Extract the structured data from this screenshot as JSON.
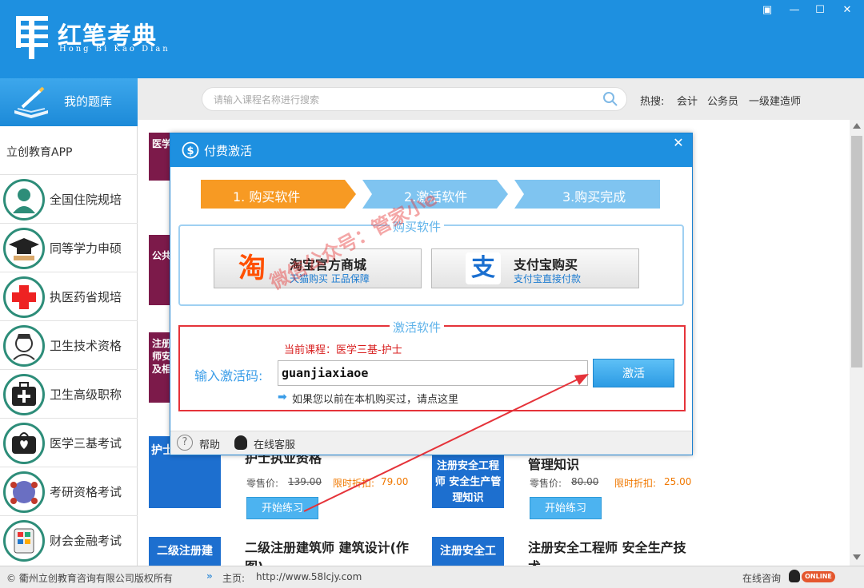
{
  "app": {
    "name_cn": "红笔考典",
    "name_en": "Hong Bi Kao Dian",
    "window_buttons": [
      "▣",
      "—",
      "☐",
      "✕"
    ]
  },
  "sidebar": {
    "header": "我的题库",
    "app_label": "立创教育APP",
    "items": [
      {
        "label": "全国住院规培",
        "icon": "doctor-icon"
      },
      {
        "label": "同等学力申硕",
        "icon": "graduation-cap-icon"
      },
      {
        "label": "执医药省规培",
        "icon": "red-cross-icon"
      },
      {
        "label": "卫生技术资格",
        "icon": "nurse-icon"
      },
      {
        "label": "卫生高级职称",
        "icon": "medical-kit-icon"
      },
      {
        "label": "医学三基考试",
        "icon": "medical-bag-icon"
      },
      {
        "label": "考研资格考试",
        "icon": "network-icon"
      },
      {
        "label": "财会金融考试",
        "icon": "calculator-icon"
      }
    ]
  },
  "search": {
    "placeholder": "请输入课程名称进行搜索"
  },
  "hot": {
    "label": "热搜:",
    "items": [
      "会计",
      "公务员",
      "一级建造师"
    ]
  },
  "content": {
    "left_cards": [
      "医学",
      "公共",
      "注册师安及相"
    ],
    "row1": [
      {
        "card": "护士执业资格",
        "title": "护士执业资格",
        "retail_label": "零售价:",
        "retail": "139.00",
        "discount_label": "限时折扣:",
        "discount": "79.00",
        "button": "开始练习"
      },
      {
        "card": "注册安全工程师 安全生产管理知识",
        "title": "管理知识",
        "retail_label": "零售价:",
        "retail": "80.00",
        "discount_label": "限时折扣:",
        "discount": "25.00",
        "button": "开始练习"
      }
    ],
    "row2": [
      {
        "card": "二级注册建",
        "title": "二级注册建筑师 建筑设计(作图)"
      },
      {
        "card": "注册安全工",
        "title": "注册安全工程师 安全生产技术"
      }
    ]
  },
  "footer": {
    "copyright": "© 衢州立创教育咨询有限公司版权所有",
    "home_label": "主页:",
    "home_url": "http://www.58lcjy.com",
    "online": "在线咨询",
    "online_badge": "ONLINE"
  },
  "modal": {
    "title": "付费激活",
    "close": "✕",
    "steps": [
      "1. 购买软件",
      "2.激活软件",
      "3.购买完成"
    ],
    "buy_section": "购买软件",
    "taobao": {
      "title": "淘宝官方商城",
      "sub": "天猫购买 正品保障",
      "glyph": "淘"
    },
    "alipay": {
      "title": "支付宝购买",
      "sub": "支付宝直接付款",
      "glyph": "支"
    },
    "activate_section": "激活软件",
    "current_course": "当前课程：医学三基-护士",
    "code_label": "输入激活码:",
    "code_value": "guanjiaxiaoe",
    "activate_button": "激活",
    "bought_link": "如果您以前在本机购买过，请点这里",
    "help": "帮助",
    "online_service": "在线客服"
  },
  "watermark": {
    "line1": "微信公众号：管家小e"
  }
}
